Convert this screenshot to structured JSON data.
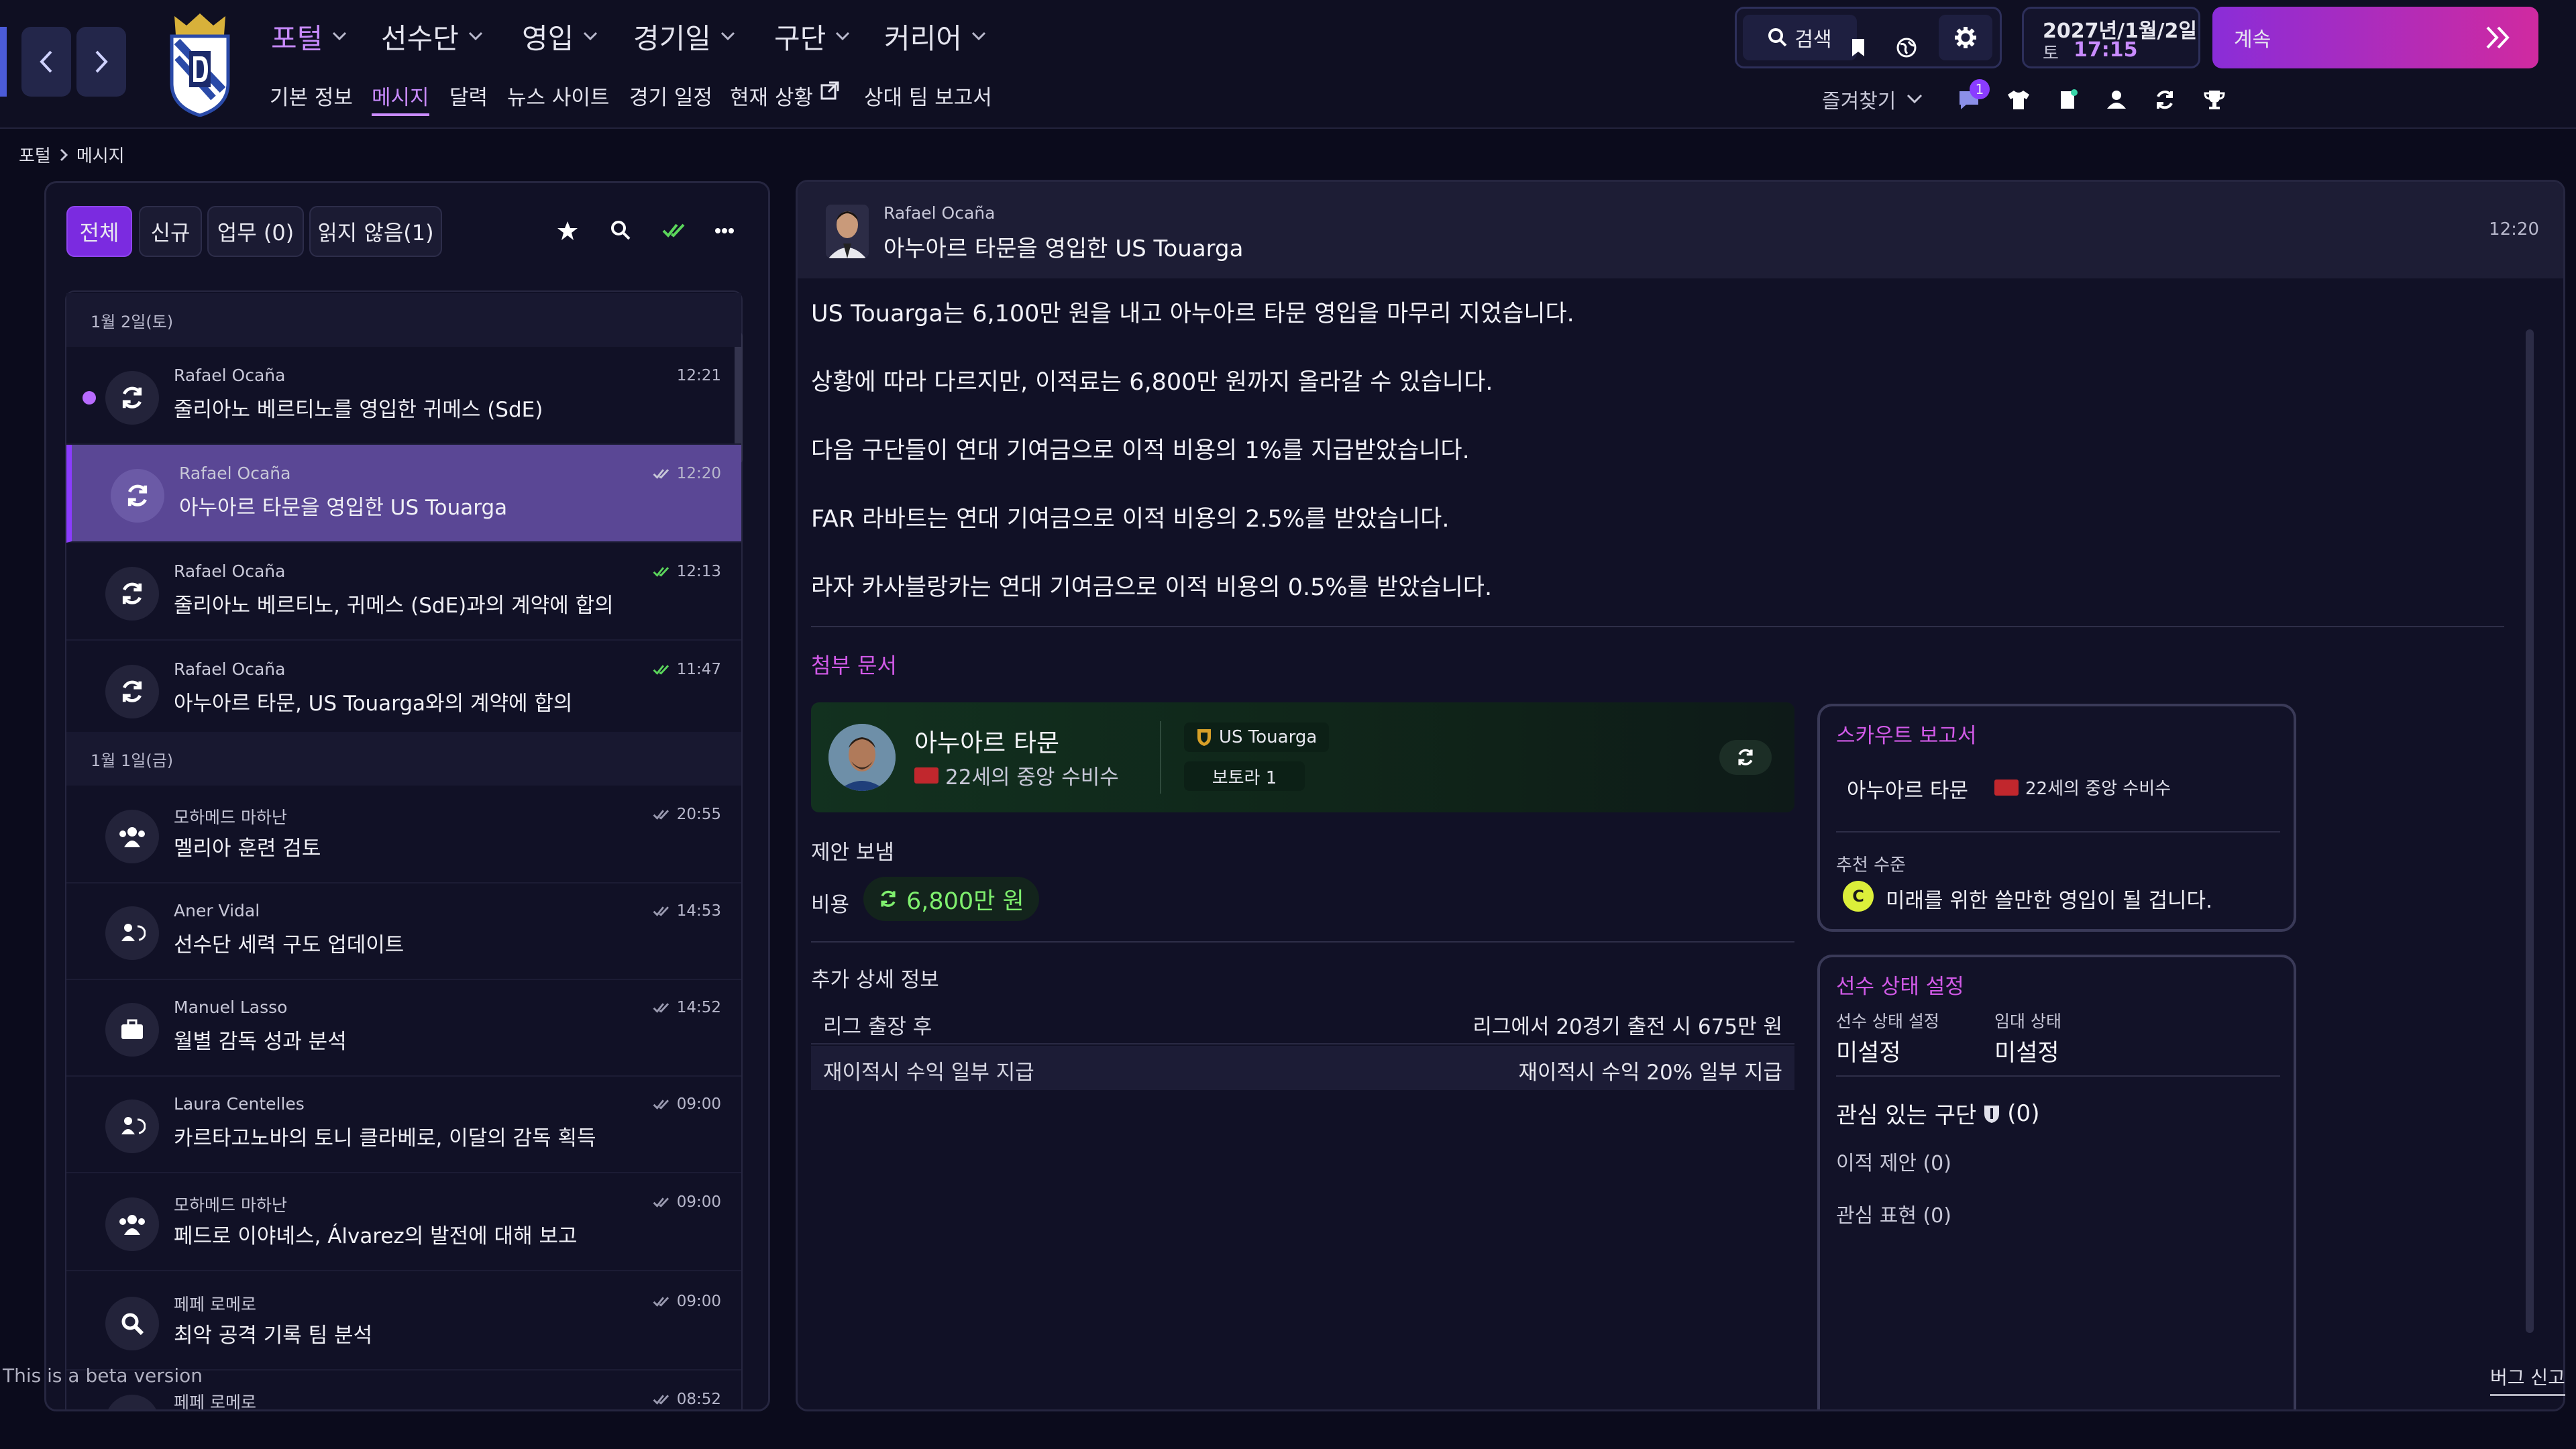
{
  "nav": {
    "main": [
      {
        "label": "포털",
        "active": true
      },
      {
        "label": "선수단"
      },
      {
        "label": "영입"
      },
      {
        "label": "경기일"
      },
      {
        "label": "구단"
      },
      {
        "label": "커리어"
      }
    ],
    "sub": [
      "기본 정보",
      "메시지",
      "달력",
      "뉴스 사이트",
      "경기 일정",
      "현재 상황",
      "상대 팀 보고서"
    ],
    "active_sub": "메시지",
    "search_label": "검색",
    "date_line1": "2027년/1월/2일",
    "weekday": "토",
    "time": "17:15",
    "continue_label": "계속",
    "favorites_label": "즐겨찾기",
    "notification_count": "1",
    "accent": "#8a3cff"
  },
  "breadcrumb": {
    "root": "포털",
    "current": "메시지"
  },
  "inbox": {
    "filters": [
      "전체",
      "신규",
      "업무 (0)",
      "읽지 않음(1)"
    ],
    "groups": [
      {
        "date": "1월 2일(토)",
        "messages": [
          {
            "sender": "Rafael Ocaña",
            "subject": "줄리아노 베르티노를 영입한 귀메스 (SdE)",
            "time": "12:21",
            "unread": true,
            "icon": "transfer-icon"
          },
          {
            "sender": "Rafael Ocaña",
            "subject": "아누아르 타문을 영입한 US Touarga",
            "time": "12:20",
            "selected": true,
            "icon": "transfer-icon"
          },
          {
            "sender": "Rafael Ocaña",
            "subject": "줄리아노 베르티노, 귀메스 (SdE)과의 계약에 합의",
            "time": "12:13",
            "icon": "transfer-icon"
          },
          {
            "sender": "Rafael Ocaña",
            "subject": "아누아르 타문, US Touarga와의 계약에 합의",
            "time": "11:47",
            "icon": "transfer-icon"
          }
        ]
      },
      {
        "date": "1월 1일(금)",
        "messages": [
          {
            "sender": "모하메드 마하난",
            "subject": "멜리아 훈련 검토",
            "time": "20:55",
            "icon": "training-icon"
          },
          {
            "sender": "Aner Vidal",
            "subject": "선수단 세력 구도 업데이트",
            "time": "14:53",
            "icon": "squad-icon"
          },
          {
            "sender": "Manuel Lasso",
            "subject": "월별 감독 성과 분석",
            "time": "14:52",
            "icon": "briefcase-icon"
          },
          {
            "sender": "Laura Centelles",
            "subject": "카르타고노바의 토니 클라베로, 이달의 감독 획득",
            "time": "09:00",
            "icon": "squad-icon"
          },
          {
            "sender": "모하메드 마하난",
            "subject": "페드로 이야녜스, Álvarez의 발전에 대해 보고",
            "time": "09:00",
            "icon": "training-icon"
          },
          {
            "sender": "페페 로메로",
            "subject": "최악 공격 기록 팀 분석",
            "time": "09:00",
            "icon": "magnifier-icon"
          },
          {
            "sender": "페페 로메로",
            "subject": "",
            "time": "08:52",
            "icon": "transfer-icon"
          }
        ]
      }
    ]
  },
  "message": {
    "sender": "Rafael Ocaña",
    "subject": "아누아르 타문을 영입한 US Touarga",
    "time": "12:20",
    "paragraphs": [
      "US Touarga는 6,100만 원을 내고 아누아르 타문 영입을 마무리 지었습니다.",
      "상황에 따라 다르지만, 이적료는 6,800만 원까지 올라갈 수 있습니다.",
      "다음 구단들이 연대 기여금으로 이적 비용의 1%를 지급받았습니다.",
      "FAR 라바트는 연대 기여금으로 이적 비용의 2.5%를 받았습니다.",
      "라자 카사블랑카는 연대 기여금으로 이적 비용의 0.5%를 받았습니다."
    ],
    "attachments_title": "첨부 문서",
    "player": {
      "name": "아누아르 타문",
      "desc": "22세의 중앙 수비수",
      "club": "US Touarga",
      "league": "보토라 1"
    },
    "offer_label": "제안 보냄",
    "fee_label": "비용",
    "fee_value": "6,800만 원",
    "details_title": "추가 상세 정보",
    "details": [
      {
        "label": "리그 출장 후",
        "value": "리그에서 20경기 출전 시 675만 원"
      },
      {
        "label": "재이적시 수익 일부 지급",
        "value": "재이적시 수익 20% 일부 지급"
      }
    ]
  },
  "scout_report": {
    "title": "스카우트 보고서",
    "player": "아누아르 타문",
    "desc": "22세의 중앙 수비수",
    "rec_label": "추천 수준",
    "grade": "C",
    "rec_text": "미래를 위한 쓸만한 영입이 될 겁니다."
  },
  "status": {
    "title": "선수 상태 설정",
    "status_label": "선수 상태 설정",
    "status_value": "미설정",
    "loan_label": "임대 상태",
    "loan_value": "미설정",
    "interested_label": "관심 있는 구단",
    "interested_count": "(0)",
    "offers": "이적 제안 (0)",
    "interest": "관심 표현 (0)"
  },
  "footer": {
    "beta": "This is a beta version",
    "bug": "버그 신고"
  }
}
